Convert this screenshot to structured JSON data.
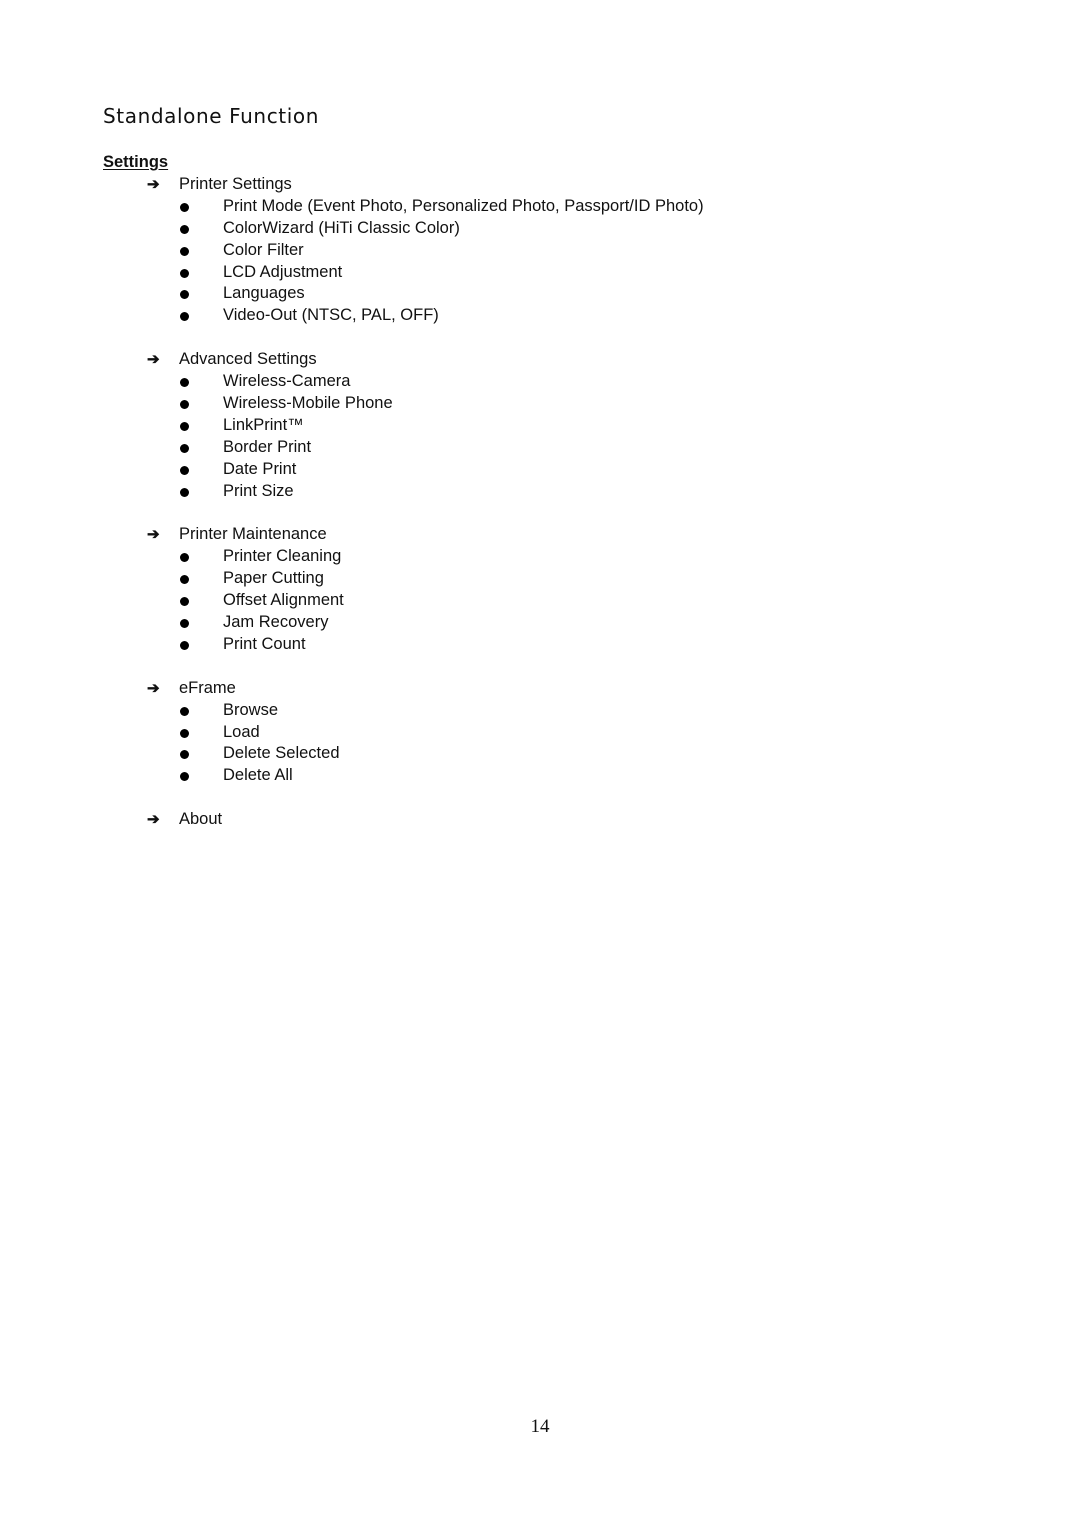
{
  "page": {
    "title": "Standalone Function",
    "section_heading": "Settings",
    "page_number": "14"
  },
  "icons": {
    "group_marker": "right-arrow-icon",
    "item_marker": "bullet-dot-icon"
  },
  "groups": [
    {
      "label": "Printer Settings",
      "items": [
        "Print Mode (Event Photo, Personalized Photo, Passport/ID Photo)",
        "ColorWizard (HiTi Classic Color)",
        "Color Filter",
        "LCD Adjustment",
        "Languages",
        "Video-Out (NTSC, PAL, OFF)"
      ]
    },
    {
      "label": "Advanced Settings",
      "items": [
        "Wireless-Camera",
        "Wireless-Mobile Phone",
        "LinkPrint™",
        "Border Print",
        "Date Print",
        "Print Size"
      ]
    },
    {
      "label": "Printer Maintenance",
      "items": [
        "Printer Cleaning",
        "Paper Cutting",
        "Offset Alignment",
        "Jam Recovery",
        "Print Count"
      ]
    },
    {
      "label": "eFrame",
      "items": [
        "Browse",
        "Load",
        "Delete Selected",
        "Delete All"
      ]
    },
    {
      "label": "About",
      "items": []
    }
  ]
}
